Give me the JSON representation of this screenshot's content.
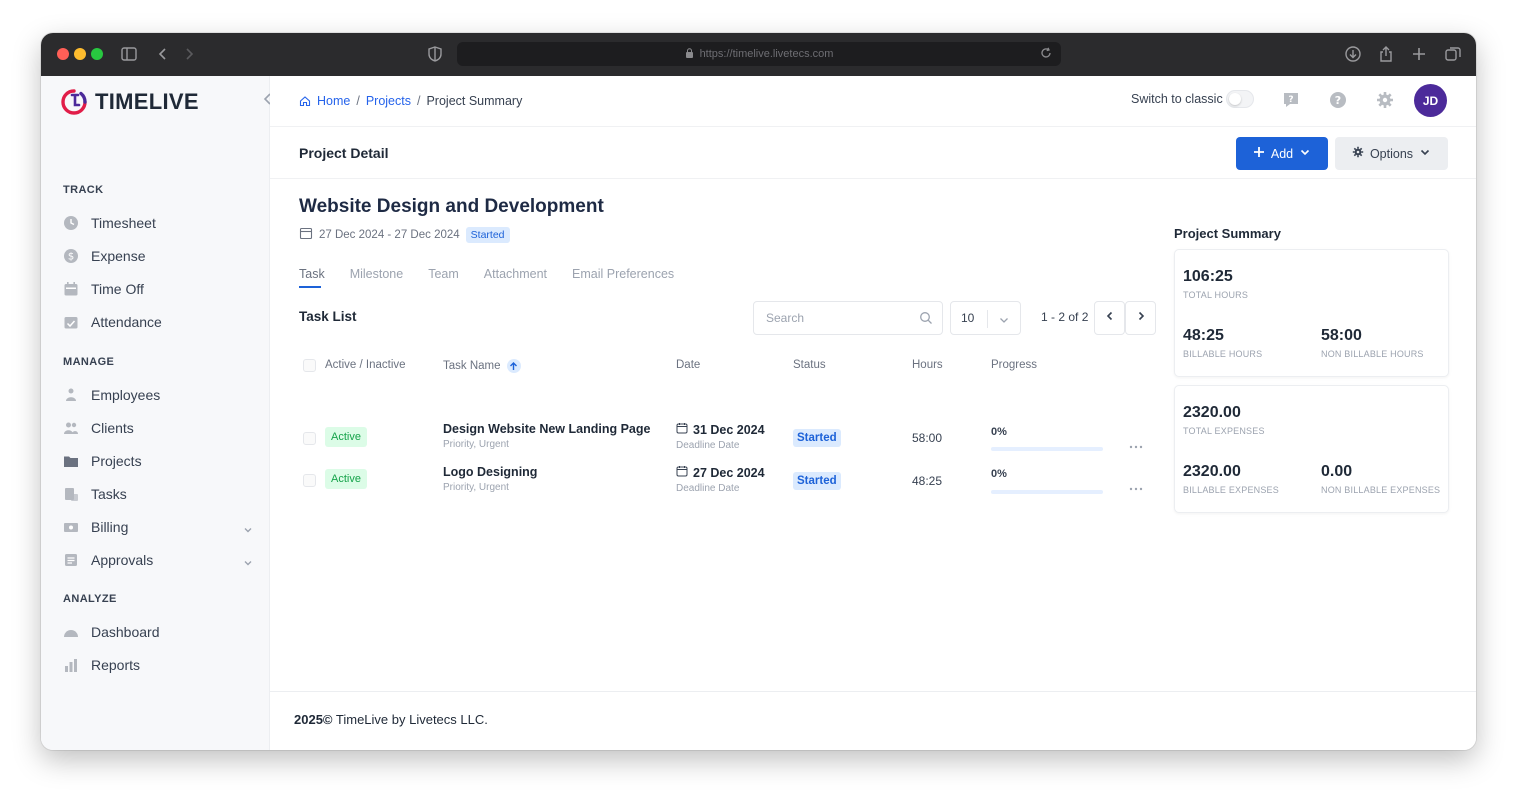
{
  "browser": {
    "url": "https://timelive.livetecs.com"
  },
  "brand": {
    "name": "TIMELIVE",
    "accent_color": "#1d62d8",
    "logo_colors": [
      "#e11d48",
      "#4c2a9a"
    ]
  },
  "sidebar": {
    "sections": [
      {
        "title": "TRACK",
        "items": [
          {
            "label": "Timesheet",
            "icon": "clock-icon"
          },
          {
            "label": "Expense",
            "icon": "dollar-icon"
          },
          {
            "label": "Time Off",
            "icon": "calendar-icon"
          },
          {
            "label": "Attendance",
            "icon": "attendance-icon"
          }
        ]
      },
      {
        "title": "MANAGE",
        "items": [
          {
            "label": "Employees",
            "icon": "employees-icon"
          },
          {
            "label": "Clients",
            "icon": "clients-icon"
          },
          {
            "label": "Projects",
            "icon": "folder-icon"
          },
          {
            "label": "Tasks",
            "icon": "tasks-icon"
          },
          {
            "label": "Billing",
            "icon": "billing-icon",
            "expandable": true
          },
          {
            "label": "Approvals",
            "icon": "approvals-icon",
            "expandable": true
          }
        ]
      },
      {
        "title": "ANALYZE",
        "items": [
          {
            "label": "Dashboard",
            "icon": "dashboard-icon"
          },
          {
            "label": "Reports",
            "icon": "reports-icon"
          }
        ]
      }
    ]
  },
  "topbar": {
    "breadcrumb": [
      "Home",
      "Projects",
      "Project Summary"
    ],
    "separator": "/",
    "switch_label": "Switch to classic",
    "avatar_initials": "JD",
    "avatar_color": "#4c2a9a"
  },
  "page": {
    "title": "Project Detail",
    "add_label": "Add",
    "options_label": "Options"
  },
  "project": {
    "name": "Website Design and Development",
    "dates": "27 Dec 2024 - 27 Dec 2024",
    "status": "Started",
    "tabs": [
      "Task",
      "Milestone",
      "Team",
      "Attachment",
      "Email Preferences"
    ]
  },
  "task_list": {
    "title": "Task List",
    "search_placeholder": "Search",
    "per_page": "10",
    "page_range": "1 - 2 of 2",
    "columns": [
      "Active / Inactive",
      "Task Name",
      "Date",
      "Status",
      "Hours",
      "Progress"
    ],
    "rows": [
      {
        "active": "Active",
        "name": "Design Website New Landing Page",
        "priority": "Priority, Urgent",
        "date": "31 Dec 2024",
        "date_label": "Deadline Date",
        "status": "Started",
        "hours": "58:00",
        "progress": "0%",
        "progress_value": 0
      },
      {
        "active": "Active",
        "name": "Logo Designing",
        "priority": "Priority, Urgent",
        "date": "27 Dec 2024",
        "date_label": "Deadline Date",
        "status": "Started",
        "hours": "48:25",
        "progress": "0%",
        "progress_value": 0
      }
    ]
  },
  "summary": {
    "title": "Project Summary",
    "total_hours": {
      "value": "106:25",
      "label": "TOTAL HOURS"
    },
    "billable_hours": {
      "value": "48:25",
      "label": "BILLABLE HOURS"
    },
    "non_billable_hours": {
      "value": "58:00",
      "label": "NON BILLABLE HOURS"
    },
    "total_expenses": {
      "value": "2320.00",
      "label": "TOTAL EXPENSES"
    },
    "billable_expenses": {
      "value": "2320.00",
      "label": "BILLABLE EXPENSES"
    },
    "non_billable_expenses": {
      "value": "0.00",
      "label": "NON BILLABLE EXPENSES"
    }
  },
  "footer": {
    "year": "2025©",
    "text": "TimeLive by Livetecs LLC."
  }
}
